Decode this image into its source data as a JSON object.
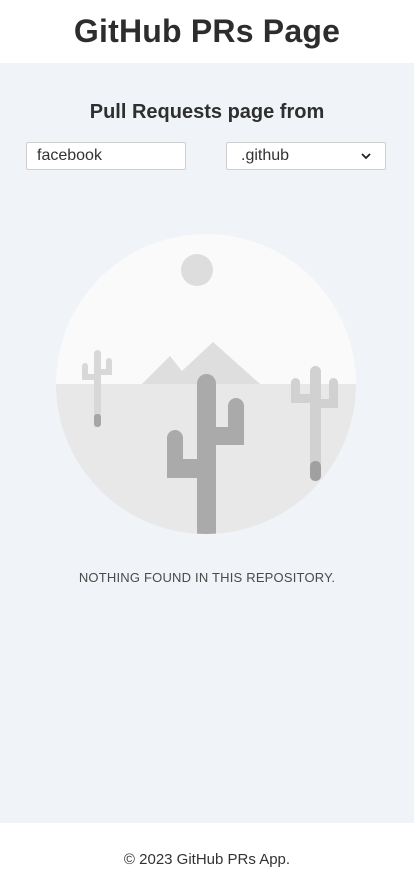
{
  "header": {
    "title": "GitHub PRs Page"
  },
  "main": {
    "subtitle": "Pull Requests page from",
    "owner_input": {
      "value": "facebook",
      "placeholder": ""
    },
    "repo_select": {
      "selected": ".github"
    },
    "illustration": {
      "icon": "empty-desert-illustration"
    },
    "empty_message": "NOTHING FOUND IN THIS REPOSITORY."
  },
  "footer": {
    "copyright": "© 2023 GitHub PRs App."
  }
}
